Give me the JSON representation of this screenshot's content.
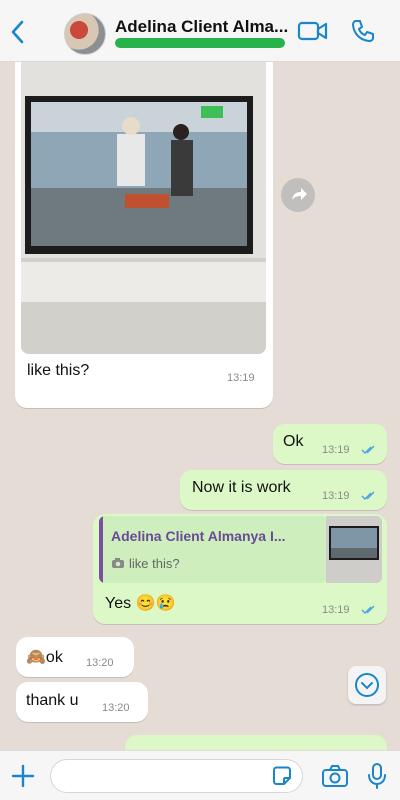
{
  "header": {
    "contact_name": "Adelina Client Alma...",
    "back_icon": "chevron-left-icon",
    "video_icon": "video-camera-icon",
    "call_icon": "phone-icon",
    "accent": "#1a86c9"
  },
  "messages": [
    {
      "id": "m1",
      "direction": "incoming",
      "type": "image",
      "caption": "like this?",
      "time": "13:19"
    },
    {
      "id": "m2",
      "direction": "outgoing",
      "text": "Ok",
      "time": "13:19",
      "read": true
    },
    {
      "id": "m3",
      "direction": "outgoing",
      "text": "Now it is work",
      "time": "13:19",
      "read": true
    },
    {
      "id": "m4",
      "direction": "outgoing",
      "type": "reply",
      "quoted": {
        "sender": "Adelina Client Almanya I...",
        "text": "like this?",
        "icon": "camera-icon"
      },
      "text": "Yes 😊😢",
      "time": "13:19",
      "read": true
    },
    {
      "id": "m5",
      "direction": "incoming",
      "text": "🙈ok",
      "time": "13:20"
    },
    {
      "id": "m6",
      "direction": "incoming",
      "text": "thank u",
      "time": "13:20"
    }
  ],
  "composer": {
    "attach_icon": "plus-icon",
    "sticker_icon": "sticker-icon",
    "camera_icon": "camera-icon",
    "mic_icon": "microphone-icon"
  },
  "colors": {
    "outgoing_bubble": "#dcf8c6",
    "incoming_bubble": "#ffffff",
    "read_ticks": "#4fa3e0",
    "online_bar": "#27b34b"
  }
}
